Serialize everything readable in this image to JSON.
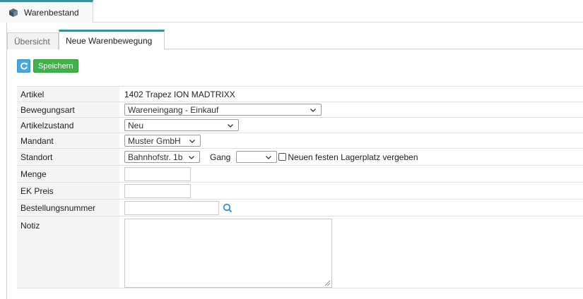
{
  "window": {
    "tab_label": "Warenbestand"
  },
  "tabs": [
    {
      "label": "Übersicht",
      "active": false
    },
    {
      "label": "Neue Warenbewegung",
      "active": true
    }
  ],
  "toolbar": {
    "refresh_icon": "refresh-icon",
    "save_label": "Speichern"
  },
  "form": {
    "artikel": {
      "label": "Artikel",
      "value": "1402 Trapez ION MADTRIXX"
    },
    "bewegungsart": {
      "label": "Bewegungsart",
      "selected": "Wareneingang - Einkauf"
    },
    "artikelzustand": {
      "label": "Artikelzustand",
      "selected": "Neu"
    },
    "mandant": {
      "label": "Mandant",
      "selected": "Muster GmbH"
    },
    "standort": {
      "label": "Standort",
      "selected": "Bahnhofstr. 1b",
      "gang_label": "Gang",
      "gang_selected": "",
      "checkbox_label": "Neuen festen Lagerplatz vergeben",
      "checkbox_checked": false
    },
    "menge": {
      "label": "Menge",
      "value": ""
    },
    "ek_preis": {
      "label": "EK Preis",
      "value": ""
    },
    "bestellungsnummer": {
      "label": "Bestellungsnummer",
      "value": ""
    },
    "notiz": {
      "label": "Notiz",
      "value": ""
    }
  },
  "colors": {
    "accent": "#3d8f9e",
    "save_button": "#3fb24a",
    "refresh_button": "#4aa8d8",
    "search_icon": "#3b8fd0"
  }
}
